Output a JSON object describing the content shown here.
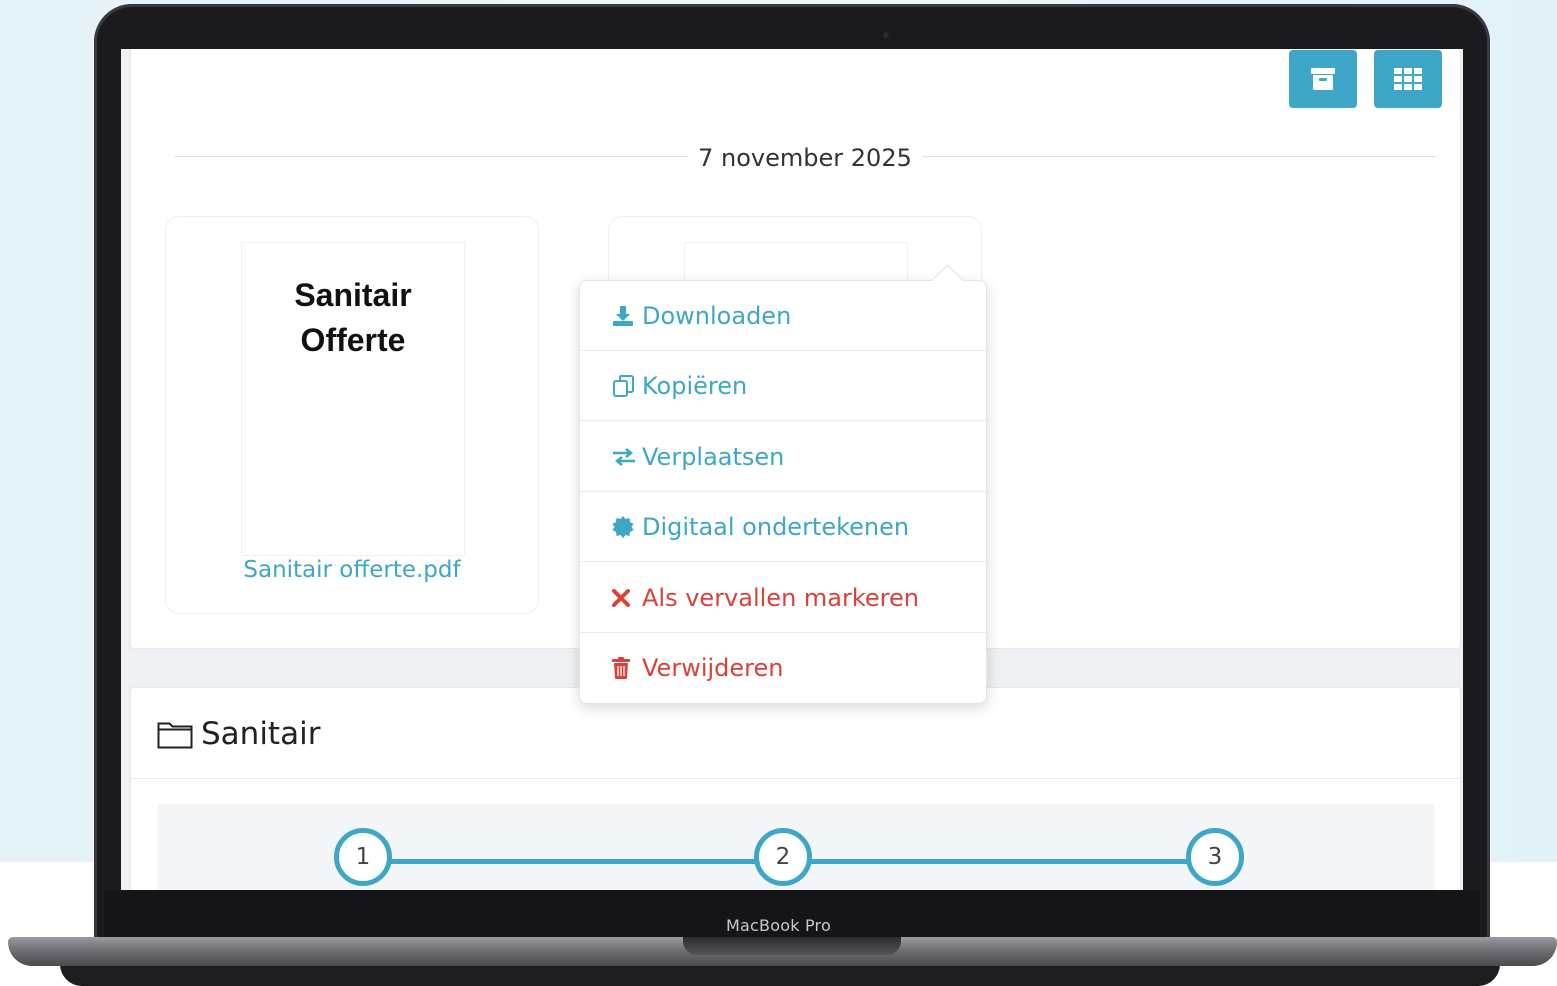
{
  "device": {
    "label": "MacBook Pro"
  },
  "toolbar": {
    "archive_icon": "archive-icon",
    "grid_icon": "grid-icon"
  },
  "timeline": {
    "date": "7 november 2025"
  },
  "files": [
    {
      "thumbnail_title_line1": "Sanitair",
      "thumbnail_title_line2": "Offerte",
      "name": "Sanitair offerte.pdf"
    }
  ],
  "context_menu": {
    "items": [
      {
        "label": "Downloaden",
        "icon": "download-icon",
        "color": "#3ea6c6"
      },
      {
        "label": "Kopiëren",
        "icon": "copy-icon",
        "color": "#3ea6c6"
      },
      {
        "label": "Verplaatsen",
        "icon": "exchange-icon",
        "color": "#3ea6c6"
      },
      {
        "label": "Digitaal ondertekenen",
        "icon": "certificate-icon",
        "color": "#3ea6c6"
      },
      {
        "label": "Als vervallen markeren",
        "icon": "close-icon",
        "color": "#d9413a"
      },
      {
        "label": "Verwijderen",
        "icon": "trash-icon",
        "color": "#d9413a"
      }
    ]
  },
  "folder": {
    "title": "Sanitair",
    "icon": "folder-icon"
  },
  "steps": [
    "1",
    "2",
    "3"
  ],
  "colors": {
    "accent": "#3ea6c6",
    "danger": "#d9413a"
  }
}
